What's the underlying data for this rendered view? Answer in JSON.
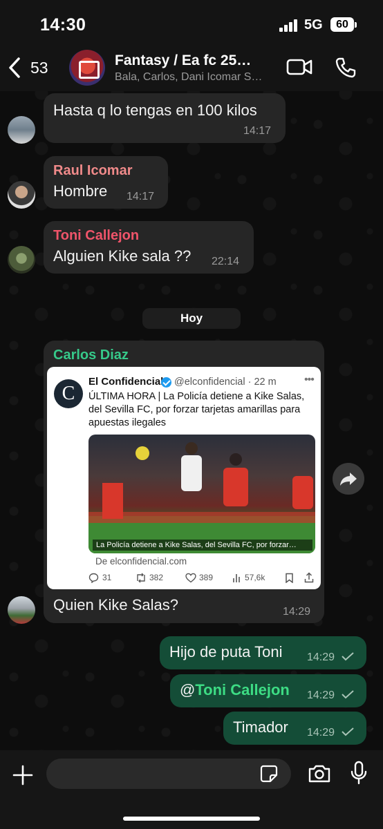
{
  "status_bar": {
    "time": "14:30",
    "network": "5G",
    "battery": "60"
  },
  "header": {
    "back_count": "53",
    "title": "Fantasy / Ea fc 25…",
    "subtitle": "Bala, Carlos, Dani Icomar S…"
  },
  "messages": [
    {
      "sender": "",
      "text": "Hasta q lo tengas en 100 kilos",
      "time": "14:17"
    },
    {
      "sender": "Raul Icomar",
      "sender_color": "#f08a8a",
      "text": "Hombre",
      "time": "14:17"
    },
    {
      "sender": "Toni Callejon",
      "sender_color": "#f0546a",
      "text": "Alguien Kike sala ??",
      "time": "22:14"
    },
    {
      "sender": "Carlos Diaz",
      "sender_color": "#36c98a",
      "text": "Quien Kike Salas?",
      "time": "14:29"
    }
  ],
  "day_separator": "Hoy",
  "tweet": {
    "logo": "C",
    "name": "El Confidencial",
    "handle": "@elconfidencial · 22 m",
    "text": "ÚLTIMA HORA | La Policía detiene a Kike Salas, del Sevilla FC, por forzar tarjetas amarillas para apuestas ilegales",
    "image_caption": "La Policía detiene a Kike Salas, del Sevilla FC, por forzar…",
    "source": "De elconfidencial.com",
    "replies": "31",
    "reposts": "382",
    "likes": "389",
    "views": "57,6k"
  },
  "outgoing": [
    {
      "text": "Hijo de puta Toni",
      "time": "14:29"
    },
    {
      "mention_at": "@",
      "mention_name": "Toni Callejon",
      "time": "14:29"
    },
    {
      "text": "Timador",
      "time": "14:29"
    }
  ],
  "colors": {
    "outgoing_bubble": "#144d37",
    "incoming_bubble": "#262626",
    "mention": "#3ddc84"
  },
  "input": {
    "placeholder": ""
  }
}
